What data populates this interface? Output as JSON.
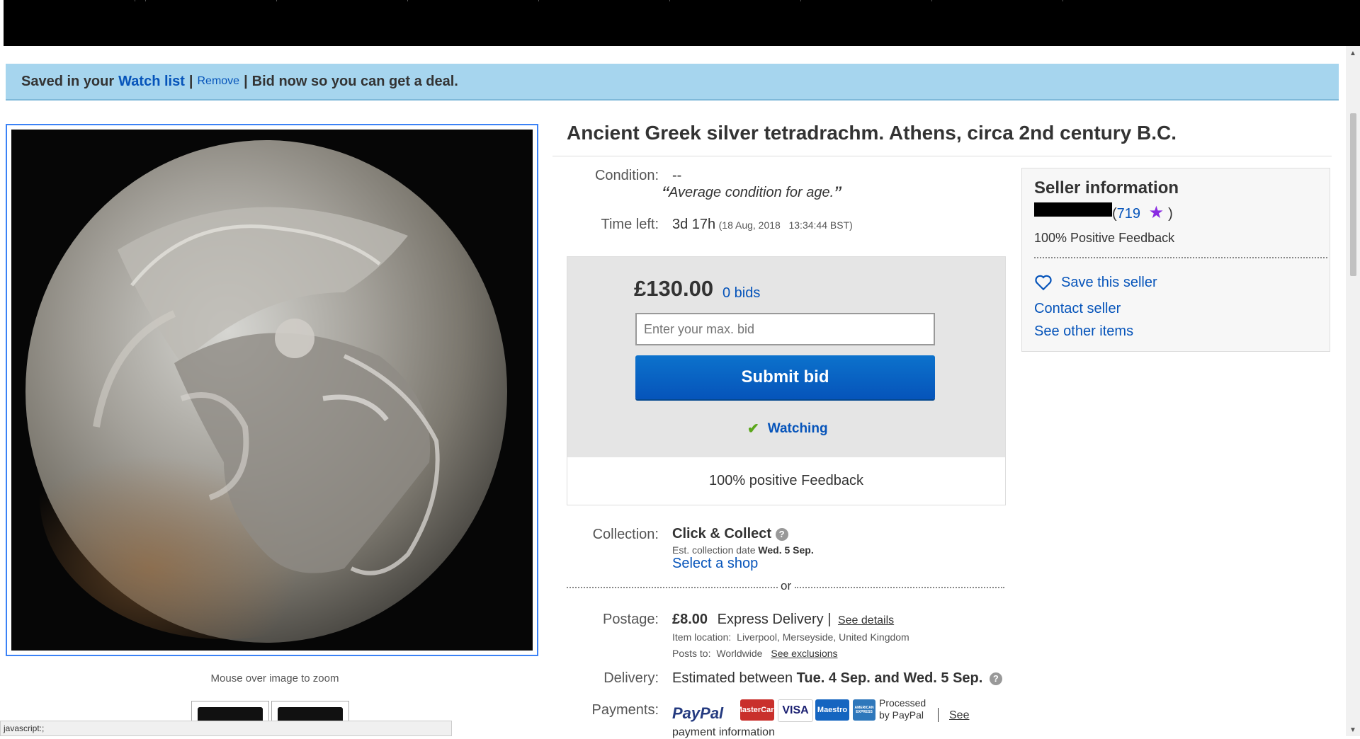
{
  "banner": {
    "prefix": "Saved in your",
    "watchlist_link": "Watch list",
    "sep1": "|",
    "remove_link": "Remove",
    "sep2": "|",
    "message": "Bid now so you can get a deal."
  },
  "gallery": {
    "zoom_hint": "Mouse over image to zoom"
  },
  "status_bar": "javascript:;",
  "item": {
    "title": "Ancient Greek silver tetradrachm. Athens, circa 2nd century B.C.",
    "condition_label": "Condition:",
    "condition_value": "--",
    "condition_note": "Average condition for age.",
    "open_quote": "“",
    "close_quote": "”",
    "time_left_label": "Time left:",
    "time_left_value": "3d 17h",
    "time_left_end": "(18 Aug, 2018   13:34:44 BST)"
  },
  "bid": {
    "price": "£130.00",
    "bids": "0 bids",
    "max_bid_placeholder": "Enter your max. bid",
    "submit": "Submit bid",
    "watching": "Watching",
    "positive_feedback": "100% positive Feedback"
  },
  "collection": {
    "label": "Collection:",
    "method": "Click & Collect",
    "est_label": "Est. collection date",
    "est_date": "Wed. 5 Sep.",
    "select_shop": "Select a shop",
    "or": "or"
  },
  "postage": {
    "label": "Postage:",
    "price": "£8.00",
    "service": "Express Delivery |",
    "see_details": "See details",
    "item_location_label": "Item location:",
    "item_location": "Liverpool, Merseyside, United Kingdom",
    "posts_to_label": "Posts to:",
    "posts_to": "Worldwide",
    "see_exclusions": "See exclusions"
  },
  "delivery": {
    "label": "Delivery:",
    "prefix": "Estimated between",
    "range": "Tue. 4 Sep. and Wed. 5 Sep."
  },
  "payments": {
    "label": "Payments:",
    "paypal": "PayPal",
    "cards": [
      "MasterCard",
      "VISA",
      "Maestro",
      "AMERICAN EXPRESS"
    ],
    "processed_line1": "Processed",
    "processed_line2": "by PayPal",
    "see": "See",
    "payment_info": "payment information"
  },
  "seller": {
    "heading": "Seller information",
    "feedback_open": "(",
    "feedback_score": "719",
    "feedback_close": ")",
    "positive": "100% Positive Feedback",
    "save_seller": "Save this seller",
    "contact": "Contact seller",
    "other_items": "See other items"
  },
  "colors": {
    "banner_bg": "#a6d5ee",
    "link": "#0654ba",
    "submit_button": "#0654ba",
    "check": "#5ba71b",
    "star": "#8a2be2"
  }
}
